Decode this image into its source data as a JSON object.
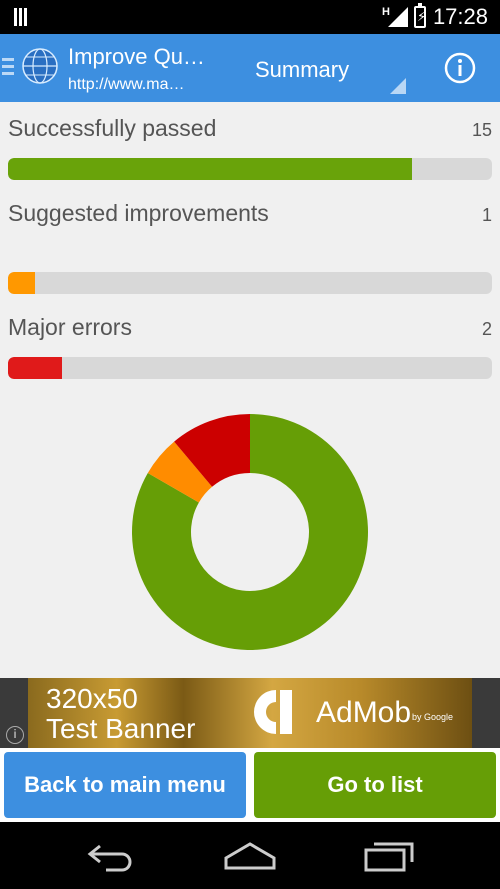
{
  "status_bar": {
    "network": "H",
    "time": "17:28",
    "icons": [
      "barcode-icon",
      "signal-icon",
      "battery-charging-icon"
    ]
  },
  "action_bar": {
    "app_icon": "globe-icon",
    "title": "Improve Qu…",
    "subtitle": "http://www.ma…",
    "spinner_label": "Summary",
    "info_icon": "info-icon"
  },
  "metrics": [
    {
      "label": "Successfully passed",
      "count": "15",
      "fraction": 0.835,
      "color": "#69a30a"
    },
    {
      "label": "Suggested improvements",
      "count": "1",
      "fraction": 0.055,
      "color": "#ff9800"
    },
    {
      "label": "Major errors",
      "count": "2",
      "fraction": 0.111,
      "color": "#e01a1a"
    }
  ],
  "chart_data": {
    "type": "pie",
    "donut": true,
    "categories": [
      "Successfully passed",
      "Suggested improvements",
      "Major errors"
    ],
    "values": [
      15,
      1,
      2
    ],
    "colors": [
      "#669e06",
      "#ff8c00",
      "#cc0000"
    ]
  },
  "ad": {
    "line1": "320x50",
    "line2": "Test Banner",
    "brand": "AdMob",
    "by": "by Google",
    "info_icon": "info-icon"
  },
  "buttons": {
    "back_label": "Back to main menu",
    "list_label": "Go to list"
  },
  "nav_bar": {
    "icons": [
      "back-icon",
      "home-icon",
      "recents-icon"
    ]
  }
}
